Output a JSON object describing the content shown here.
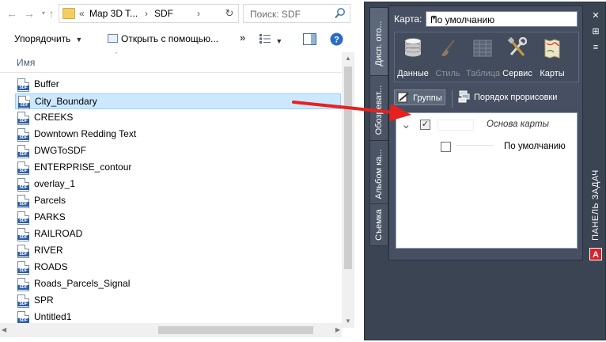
{
  "explorer": {
    "nav": {
      "back_icon": "arrow-left",
      "forward_icon": "arrow-right",
      "recent_icon": "chevron-down",
      "up_icon": "arrow-up"
    },
    "address": {
      "overflow": "«",
      "crumb1": "Map 3D T...",
      "sep1": "›",
      "crumb2": "SDF",
      "sep2": "›",
      "refresh_icon": "↻"
    },
    "search": {
      "placeholder": "Поиск: SDF"
    },
    "toolbar": {
      "organize_label": "Упорядочить",
      "organize_arrow": "▼",
      "open_with_label": "Открыть с помощью...",
      "more": "»",
      "view_arrow": "▼"
    },
    "column_header": "Имя",
    "files": [
      {
        "name": "Buffer",
        "selected": false
      },
      {
        "name": "City_Boundary",
        "selected": true
      },
      {
        "name": "CREEKS",
        "selected": false
      },
      {
        "name": "Downtown Redding Text",
        "selected": false
      },
      {
        "name": "DWGToSDF",
        "selected": false
      },
      {
        "name": "ENTERPRISE_contour",
        "selected": false
      },
      {
        "name": "overlay_1",
        "selected": false
      },
      {
        "name": "Parcels",
        "selected": false
      },
      {
        "name": "PARKS",
        "selected": false
      },
      {
        "name": "RAILROAD",
        "selected": false
      },
      {
        "name": "RIVER",
        "selected": false
      },
      {
        "name": "ROADS",
        "selected": false
      },
      {
        "name": "Roads_Parcels_Signal",
        "selected": false
      },
      {
        "name": "SPR",
        "selected": false
      },
      {
        "name": "Untitled1",
        "selected": false
      }
    ],
    "file_icon_text": "SDF"
  },
  "taskpane": {
    "tabs": [
      "Дисп. ото...",
      "Обозреват...",
      "Альбом ка...",
      "Съемка"
    ],
    "karta_label": "Карта:",
    "karta_value": "По умолчанию",
    "karta_arrow": "▼",
    "ribbon": [
      {
        "label": "Данные",
        "icon": "database-icon",
        "disabled": false
      },
      {
        "label": "Стиль",
        "icon": "brush-icon",
        "disabled": true
      },
      {
        "label": "Таблица",
        "icon": "table-icon",
        "disabled": true
      },
      {
        "label": "Сервис",
        "icon": "tools-icon",
        "disabled": false
      },
      {
        "label": "Карты",
        "icon": "map-icon",
        "disabled": false
      }
    ],
    "groups_label": "Группы",
    "draw_order_label": "Порядок прорисовки",
    "tree": {
      "base_label": "Основа карты",
      "base_checked": "✓",
      "default_label": "По умолчанию"
    },
    "right_strip": {
      "close": "✕",
      "pin": "⊞",
      "menu": "≡",
      "title": "ПАНЕЛЬ ЗАДАЧ",
      "logo": "A"
    }
  },
  "colors": {
    "selection_bg": "#cce8ff",
    "taskpane_bg": "#3b4453",
    "arrow": "#e8201e"
  }
}
